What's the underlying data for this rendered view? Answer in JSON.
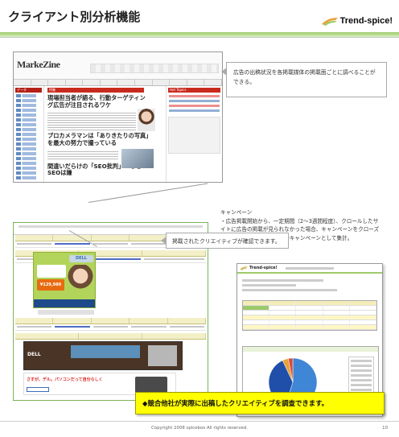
{
  "slide": {
    "title": "クライアント別分析機能",
    "logo_text": "Trend-spice!",
    "footer": "Copyright 2008 spicebox All rights reserved.",
    "page_number": "10"
  },
  "markezine": {
    "logo_text": "MarkeZine",
    "side_header": "データ",
    "main_header": "特集",
    "right_header": "Hot Topics",
    "headline_1": "現場担当者が語る、行動ターゲティング広告が注目されるワケ",
    "headline_2": "プロカメラマンは「ありきたりの写真」を最大の努力で撮っている",
    "headline_3": "間違いだらけの「SEO批判」～なぜSEOは嫌"
  },
  "callouts": {
    "callout_1": "広告の出稿状況を各掲載媒体の掲載面ごとに調べることができる。",
    "campaign_title": "キャンペーン",
    "campaign_text": "・広告掲載開始から、一定期間（2～3週間程度）、クロールしたサイトに広告の掲載が見られなかった場合、キャンペーンをクローズしたとみなし、該当期間を一キャンペーンとして集計。",
    "callout_3": "掲載されたクリエイティブが確認できます。"
  },
  "ads": {
    "creative_1_price": "¥129,980",
    "creative_1_brand": "DELL",
    "creative_3_brand": "DELL",
    "creative_4_text": "さすが、デル。パソコンだって自分らしく"
  },
  "highlight": {
    "text": "◆競合他社が実際に出稿したクリエイティブを調査できます。"
  },
  "colors": {
    "accent_green": "#9ecb6a",
    "highlight_yellow": "#ffff00",
    "markezine_red": "#c92a1e"
  },
  "chart_data": {
    "type": "pie",
    "categories": [],
    "values": [
      55,
      38,
      4,
      3
    ],
    "colors": [
      "#3f86d6",
      "#1f4fa8",
      "#e8a23a",
      "#d94a3a"
    ]
  }
}
